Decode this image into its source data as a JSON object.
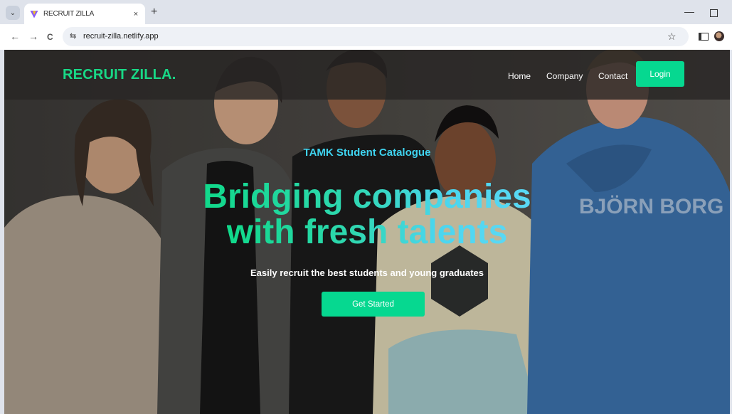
{
  "browser": {
    "tab_title": "RECRUIT ZILLA",
    "tab_close_glyph": "×",
    "new_tab_glyph": "+",
    "tab_menu_glyph": "⌄",
    "back_glyph": "←",
    "forward_glyph": "→",
    "reload_glyph": "C",
    "site_info_glyph": "⇆",
    "url": "recruit-zilla.netlify.app",
    "star_glyph": "☆",
    "minimize_glyph": "—",
    "icons": [
      "vite-favicon",
      "chevron-down-icon",
      "close-icon",
      "plus-icon",
      "back-arrow-icon",
      "forward-arrow-icon",
      "reload-icon",
      "site-info-icon",
      "star-icon",
      "side-panel-icon",
      "profile-avatar",
      "minimize-icon",
      "maximize-icon"
    ]
  },
  "nav": {
    "brand": "RECRUIT ZILLA.",
    "links": [
      "Home",
      "Company",
      "Contact"
    ],
    "login_label": "Login"
  },
  "hero": {
    "eyebrow": "TAMK Student Catalogue",
    "headline_line1": "Bridging companies",
    "headline_line2": "with fresh talents",
    "subheading": "Easily recruit the best students and young graduates",
    "cta_label": "Get Started"
  },
  "colors": {
    "accent_green": "#06d890",
    "brand_green": "#18d886",
    "eyebrow_cyan": "#3fd4f0",
    "headline_gradient_start": "#10d98a",
    "headline_gradient_end": "#5ad8f4",
    "nav_background": "#2a2826"
  }
}
